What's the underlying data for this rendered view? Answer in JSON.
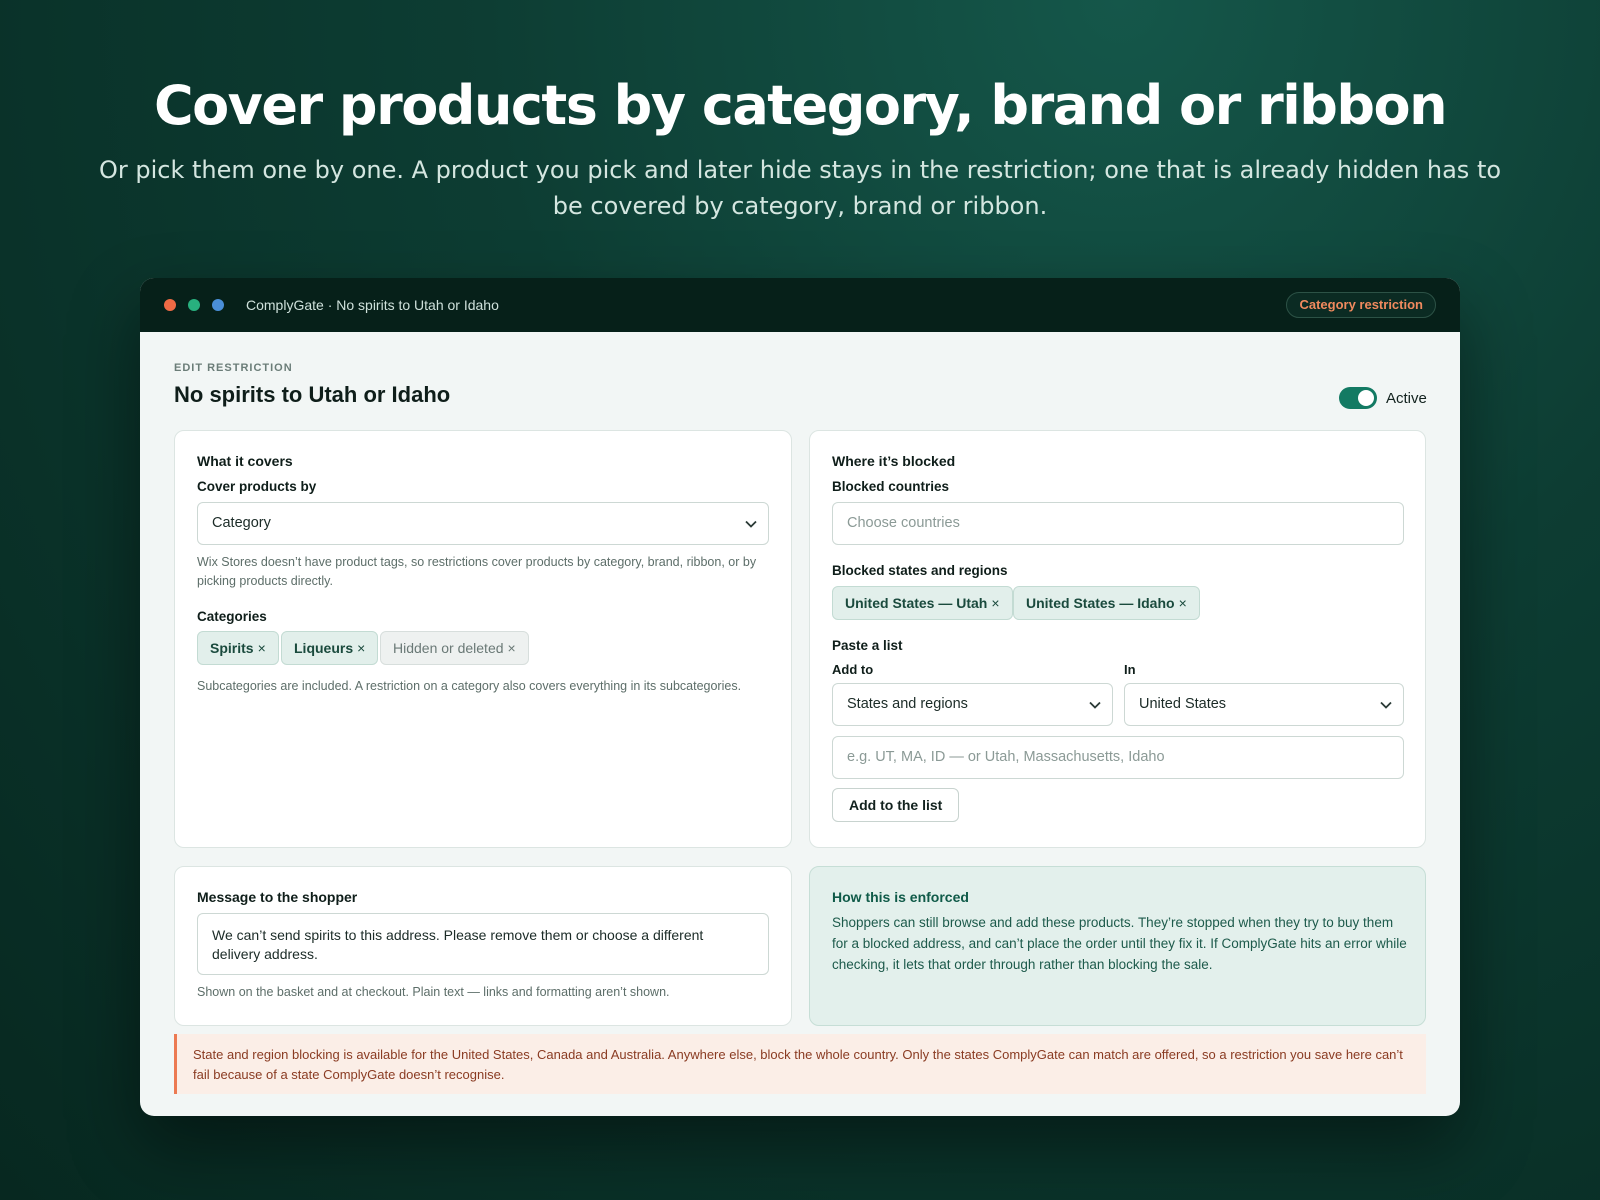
{
  "hero": {
    "title": "Cover products by category, brand or ribbon",
    "subtitle": "Or pick them one by one. A product you pick and later hide stays in the restriction; one that is already hidden has to be covered by category, brand or ribbon."
  },
  "window": {
    "title": "ComplyGate · No spirits to Utah or Idaho",
    "badge": "Category restriction",
    "dots": [
      "red",
      "green",
      "blue"
    ]
  },
  "page": {
    "eyebrow": "EDIT RESTRICTION",
    "title": "No spirits to Utah or Idaho",
    "active_label": "Active",
    "active": true
  },
  "cover": {
    "heading": "What it covers",
    "cover_by_label": "Cover products by",
    "cover_by_value": "Category",
    "cover_help": "Wix Stores doesn’t have product tags, so restrictions cover products by category, brand, ribbon, or by picking products directly.",
    "categories_label": "Categories",
    "categories": [
      {
        "label": "Spirits",
        "remove": "×"
      },
      {
        "label": "Liqueurs",
        "remove": "×"
      },
      {
        "label": "Hidden or deleted",
        "remove": "×"
      }
    ],
    "categories_help": "Subcategories are included. A restriction on a category also covers everything in its subcategories."
  },
  "where": {
    "heading": "Where it’s blocked",
    "countries_label": "Blocked countries",
    "countries_placeholder": "Choose countries",
    "regions_label": "Blocked states and regions",
    "regions": [
      {
        "label": "United States — Utah",
        "remove": "×"
      },
      {
        "label": "United States — Idaho",
        "remove": "×"
      }
    ],
    "paste_label": "Paste a list",
    "add_to_label": "Add to",
    "add_to_value": "States and regions",
    "in_label": "In",
    "in_value": "United States",
    "list_placeholder": "e.g. UT, MA, ID — or Utah, Massachusetts, Idaho",
    "add_button": "Add to the list"
  },
  "message": {
    "heading": "Message to the shopper",
    "value": "We can’t send spirits to this address. Please remove them or choose a different delivery address.",
    "help": "Shown on the basket and at checkout. Plain text — links and formatting aren’t shown."
  },
  "enforced": {
    "heading": "How this is enforced",
    "body": "Shoppers can still browse and add these products. They’re stopped when they try to buy them for a blocked address, and can’t place the order until they fix it. If ComplyGate hits an error while checking, it lets that order through rather than blocking the sale."
  },
  "notice": {
    "text": "State and region blocking is available for the United States, Canada and Australia. Anywhere else, block the whole country. Only the states ComplyGate can match are offered, so a restriction you save here can’t fail because of a state ComplyGate doesn’t recognise."
  },
  "colors": {
    "accent": "#137a63",
    "badge_text": "#f08a5e",
    "notice_border": "#ec7a52"
  },
  "icons": {
    "dropdown": "chevron-down-icon",
    "remove": "close-icon"
  }
}
